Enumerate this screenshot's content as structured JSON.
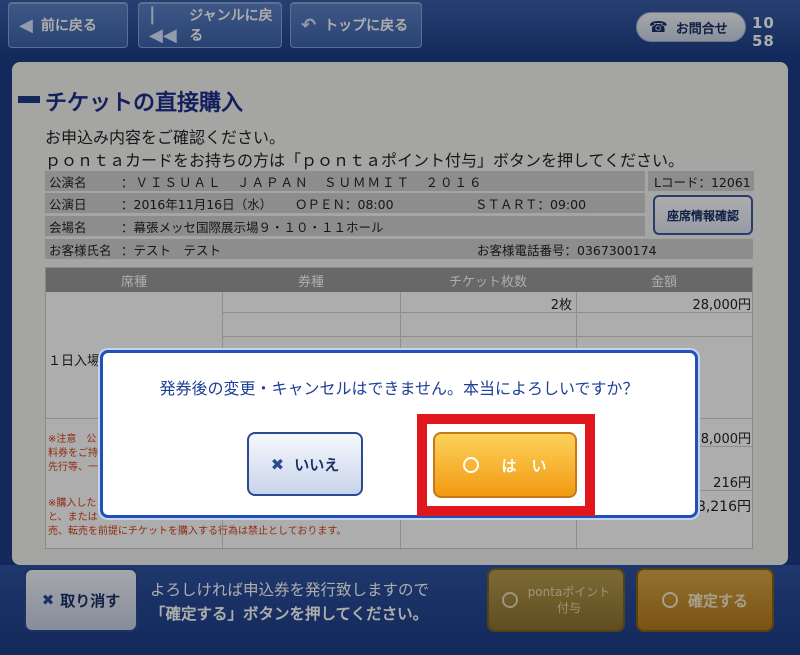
{
  "nav": {
    "back": "前に戻る",
    "genre": "ジャンルに戻る",
    "top": "トップに戻る",
    "inquiry": "お問合せ",
    "clock": "10 58"
  },
  "page": {
    "title": "チケットの直接購入",
    "instruction1": "お申込み内容をご確認ください。",
    "instruction2": "ｐｏｎｔａカードをお持ちの方は「ｐｏｎｔａポイント付与」ボタンを押してください。"
  },
  "info": {
    "performance_label": "公演名",
    "performance_value": "：ＶＩＳＵＡＬ　ＪＡＰＡＮ　ＳＵＭＭＩＴ　２０１６",
    "lcode": "Lコード：12061",
    "date_label": "公演日",
    "date_value": "：2016年11月16日（水）",
    "open": "ＯＰＥＮ：08:00",
    "start": "ＳＴＡＲＴ：09:00",
    "venue_label": "会場名",
    "venue_value": "：幕張メッセ国際展示場９・１０・１１ホール",
    "customer_label": "お客様氏名",
    "customer_value": "：テスト　テスト",
    "phone": "お客様電話番号：0367300174",
    "seat_button": "座席情報確認"
  },
  "table": {
    "headers": [
      "席種",
      "券種",
      "チケット枚数",
      "金額"
    ],
    "seat_type": "１日入場券",
    "quantity": "2枚",
    "price": "28,000円",
    "subtotal": "28,000円",
    "fee": "216円",
    "total": "28,216円",
    "note1": "※注意　公",
    "note2": "料券をご持",
    "note3": "先行等、一",
    "note4": "※購入した",
    "note5": "と、または",
    "note6": "売、転売を前提にチケットを購入する行為は禁止としております。"
  },
  "dialog": {
    "message": "発券後の変更・キャンセルはできません。本当によろしいですか？",
    "no": "いいえ",
    "yes": "は　い"
  },
  "footer": {
    "cancel": "取り消す",
    "line1": "よろしければ申込券を発行致しますので",
    "line2": "「確定する」ボタンを押してください。",
    "ponta_line1": "pontaポイント",
    "ponta_line2": "付与",
    "confirm": "確定する"
  },
  "colors": {
    "highlight": "#e0171c",
    "yes_button": "#f29a12",
    "dialog_border": "#2050b8"
  }
}
